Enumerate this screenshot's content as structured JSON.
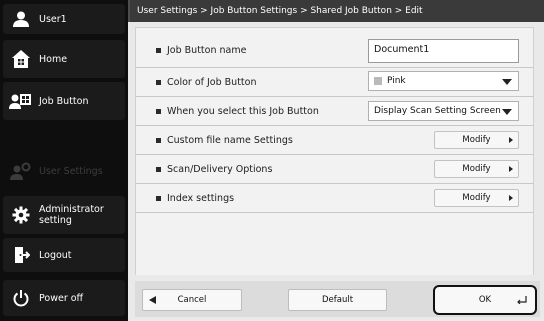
{
  "sidebar": {
    "user": {
      "label": "User1",
      "icon": "user-icon"
    },
    "items": [
      {
        "label": "Home",
        "icon": "home-icon"
      },
      {
        "label": "Job Button",
        "icon": "job-button-icon"
      },
      {
        "label": "User Settings",
        "icon": "user-settings-icon"
      },
      {
        "label": "Administrator setting",
        "icon": "gear-icon"
      },
      {
        "label": "Logout",
        "icon": "logout-icon"
      },
      {
        "label": "Power off",
        "icon": "power-icon"
      }
    ]
  },
  "breadcrumb": "User Settings > Job Button Settings > Shared Job Button > Edit",
  "form": {
    "job_button_name": {
      "label": "Job Button name",
      "value": "Document1"
    },
    "color": {
      "label": "Color of Job Button",
      "value": "Pink",
      "swatch_color": "#b9b9b9"
    },
    "on_select": {
      "label": "When you select this Job Button",
      "value": "Display Scan Setting Screen"
    },
    "custom_file_name": {
      "label": "Custom file name Settings",
      "button": "Modify"
    },
    "scan_delivery": {
      "label": "Scan/Delivery Options",
      "button": "Modify"
    },
    "index_settings": {
      "label": "Index settings",
      "button": "Modify"
    }
  },
  "footer": {
    "cancel": "Cancel",
    "default": "Default",
    "ok": "OK"
  },
  "colors": {
    "sidebar_bg": "#0e0e0e",
    "breadcrumb_bg": "#3a3a3a",
    "main_bg": "#e9e9e9"
  }
}
